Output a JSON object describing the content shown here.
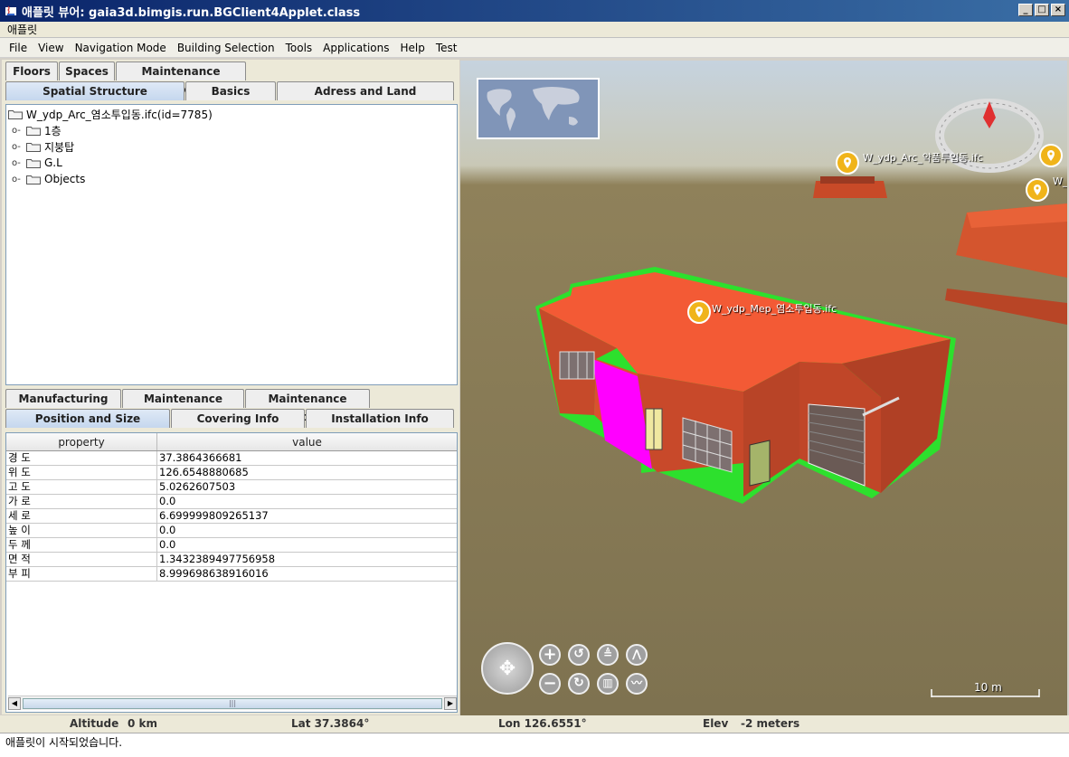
{
  "window": {
    "title": "애플릿 뷰어: gaia3d.bimgis.run.BGClient4Applet.class",
    "applet_label": "애플릿"
  },
  "menu": [
    "File",
    "View",
    "Navigation Mode",
    "Building Selection",
    "Tools",
    "Applications",
    "Help",
    "Test"
  ],
  "top_tabs_row1": [
    "Floors",
    "Spaces",
    "Maintenance Records"
  ],
  "top_tabs_row2": [
    "Spatial Structure",
    "Basics",
    "Adress and Land"
  ],
  "tree": {
    "root": "W_ydp_Arc_염소투입동.ifc(id=7785)",
    "children": [
      "1층",
      "지붕탑",
      "G.L",
      "Objects"
    ]
  },
  "bottom_tabs_row1": [
    "Manufacturing Info",
    "Maintenance History",
    "Maintenance Criteria"
  ],
  "bottom_tabs_row2": [
    "Position and Size",
    "Covering Info",
    "Installation Info"
  ],
  "props_table": {
    "columns": [
      "property",
      "value"
    ],
    "rows": [
      [
        "경 도",
        "37.3864366681"
      ],
      [
        "위 도",
        "126.6548880685"
      ],
      [
        "고 도",
        "5.0262607503"
      ],
      [
        "가 로",
        "0.0"
      ],
      [
        "세 로",
        "6.699999809265137"
      ],
      [
        "높 이",
        "0.0"
      ],
      [
        "두 께",
        "0.0"
      ],
      [
        "면 적",
        "1.3432389497756958"
      ],
      [
        "부 피",
        "8.999698638916016"
      ]
    ]
  },
  "viewport": {
    "labels": {
      "building_main": "W_ydp_Mep_염소투입동.ifc",
      "building_far": "W_ydp_Arc_약품투입동.ifc",
      "building_right": "W_"
    },
    "scale_label": "10 m"
  },
  "status": {
    "altitude_label": "Altitude",
    "altitude_value": "0 km",
    "lat": "Lat 37.3864°",
    "lon": "Lon 126.6551°",
    "elev_label": "Elev",
    "elev_value": "-2 meters"
  },
  "bottom_message": "애플릿이 시작되었습니다."
}
